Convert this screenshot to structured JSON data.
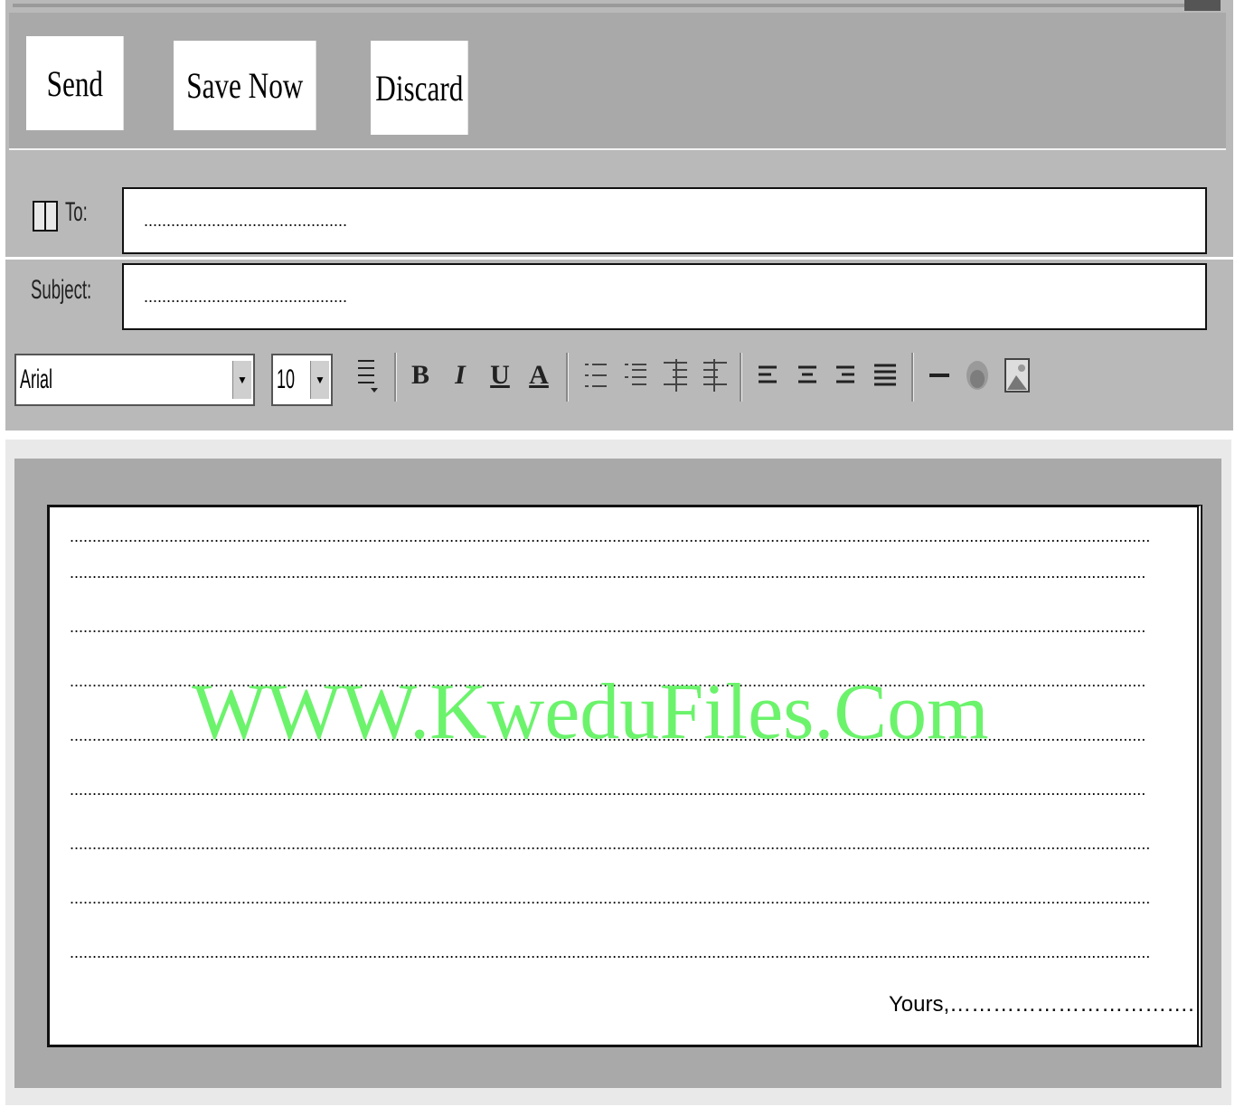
{
  "toolbar": {
    "send_label": "Send",
    "save_label": "Save Now",
    "discard_label": "Discard"
  },
  "fields": {
    "to_label": "To:",
    "to_value": ".............................................",
    "subject_label": "Subject:",
    "subject_value": "............................................."
  },
  "format_bar": {
    "font_name": "Arial",
    "font_size": "10",
    "icons": [
      "text-style-icon",
      "bold-icon",
      "italic-icon",
      "underline-icon",
      "font-color-icon",
      "numbered-list-icon",
      "bullet-list-icon",
      "decrease-indent-icon",
      "increase-indent-icon",
      "align-left-icon",
      "align-center-icon",
      "align-right-icon",
      "justify-icon",
      "horizontal-rule-icon",
      "link-icon",
      "image-icon"
    ],
    "bold": "B",
    "italic": "I",
    "underline": "U",
    "font_color": "A"
  },
  "body": {
    "lines": [
      "...............................................................................................................................................................................................................................................",
      "..............................................................................................................................................................................................................................................",
      "..............................................................................................................................................................................................................................................",
      "..............................................................................................................................................................................................................................................",
      "..............................................................................................................................................................................................................................................",
      "..............................................................................................................................................................................................................................................",
      "...............................................................................................................................................................................................................................................",
      "...............................................................................................................................................................................................................................................",
      "..............................................................................................................................................................................................................................................."
    ],
    "closing": "Yours,……………………………."
  },
  "watermark": "WWW.KweduFiles.Com",
  "colors": {
    "toolbar_bg": "#a9a9a9",
    "watermark": "#6cf36c"
  }
}
